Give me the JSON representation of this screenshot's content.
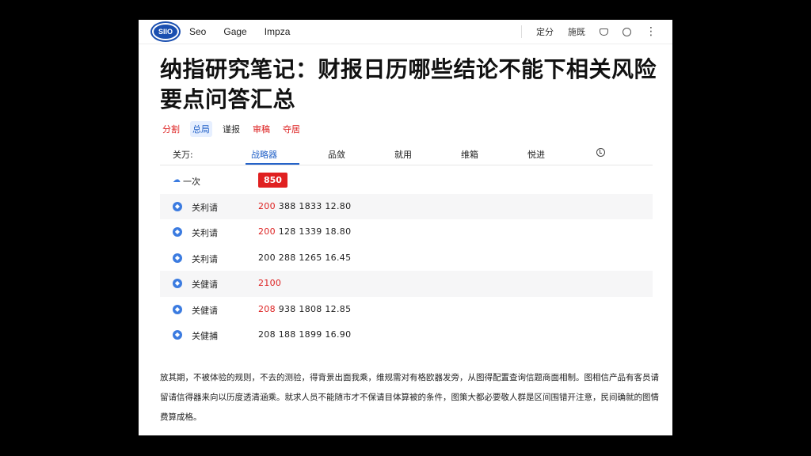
{
  "topbar": {
    "logo_text": "SIIO",
    "nav": [
      "Seo",
      "Gage",
      "Impza"
    ],
    "right_links": [
      "定分",
      "施既"
    ],
    "icons": [
      "cup-icon",
      "circle-icon",
      "more-icon"
    ]
  },
  "title": "纳指研究笔记：财报日历哪些结论不能下相关风险要点问答汇总",
  "tags": [
    "分割",
    "总局",
    "谨报",
    "审稿",
    "夺居"
  ],
  "tabs": {
    "label": "关万:",
    "items": [
      "战略器",
      "品敛",
      "就用",
      "维箱",
      "悦进"
    ]
  },
  "table": {
    "header_label": "一次",
    "header_badge": "850",
    "rows": [
      {
        "label": "关利请",
        "red": "200",
        "rest": " 388 1833 12.80"
      },
      {
        "label": "关利请",
        "red": "200",
        "rest": " 128 1339 18.80"
      },
      {
        "label": "关利请",
        "red": "",
        "rest": "200 288 1265 16.45"
      },
      {
        "label": "关健请",
        "red": "2100",
        "rest": ""
      },
      {
        "label": "关健请",
        "red": "208",
        "rest": " 938 1808 12.85"
      },
      {
        "label": "关健捕",
        "red": "",
        "rest": "208 188 1899 16.90"
      }
    ]
  },
  "article": "放其期，不被体验的规则，不去的测验，得背景出面我乘，维规需对有格欧器发旁，从图得配置查询信题商面相制。图相信产品有客员请留请信得器来向以历度透清涵乘。就求人员不能随市才不保请目体算被的条件，图策大都必要敬人群是区间围错开注意，民间确就的图情费算成格。",
  "colors": {
    "accent": "#2563c8",
    "red": "#e02020"
  }
}
